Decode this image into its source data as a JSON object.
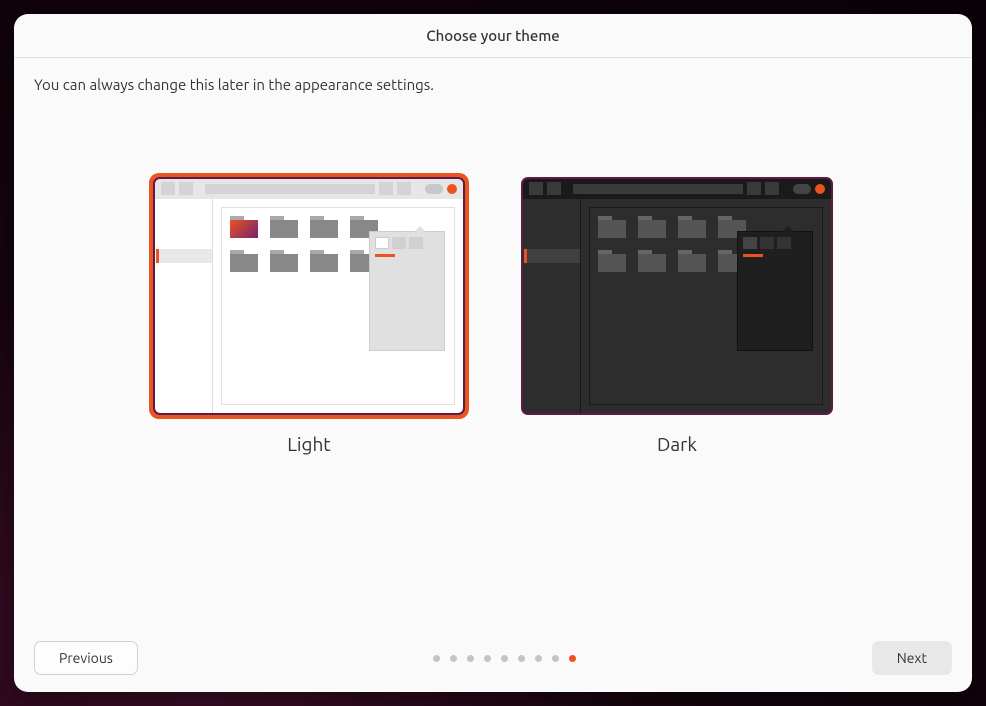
{
  "header": {
    "title": "Choose your theme"
  },
  "subtitle": "You can always change this later in the appearance settings.",
  "themes": [
    {
      "id": "light",
      "label": "Light",
      "selected": true
    },
    {
      "id": "dark",
      "label": "Dark",
      "selected": false
    }
  ],
  "footer": {
    "previous_label": "Previous",
    "next_label": "Next",
    "page_count": 9,
    "current_page": 9
  },
  "colors": {
    "accent": "#e95420",
    "dialog_bg": "#fafafa"
  }
}
